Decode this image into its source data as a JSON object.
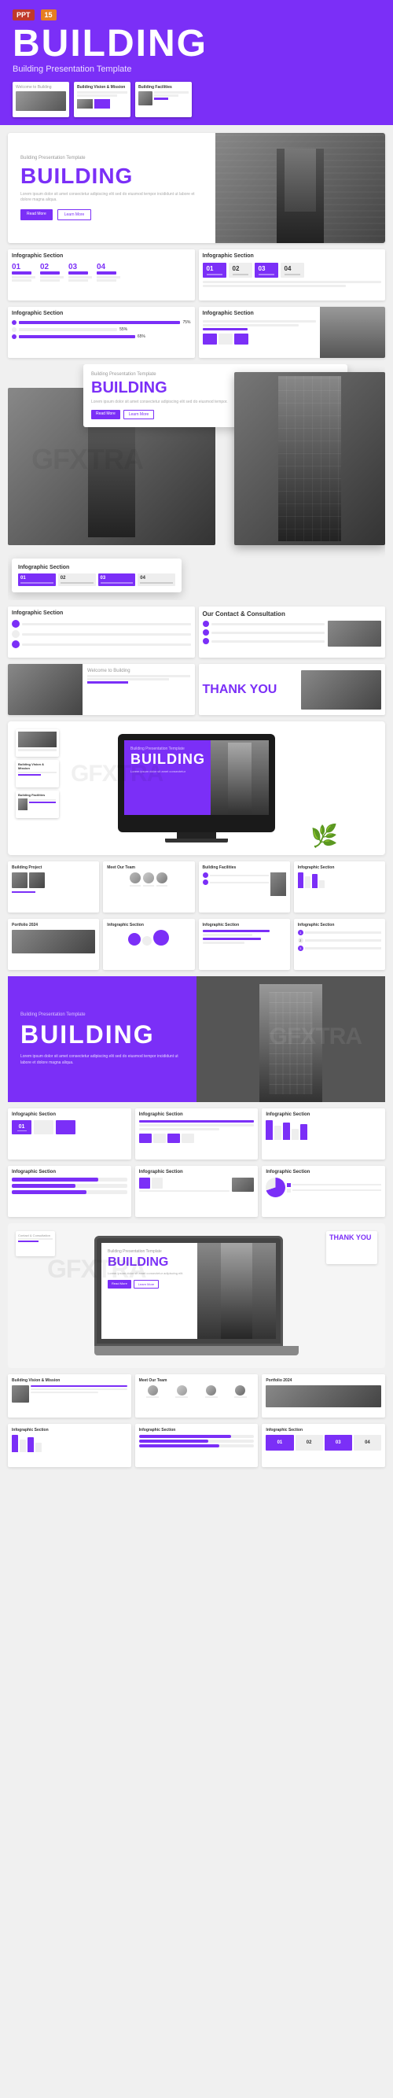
{
  "header": {
    "format_badge": "PPT",
    "extra_badge": "15",
    "title": "BUILDING",
    "subtitle": "Building Presentation Template"
  },
  "slides": {
    "cover": {
      "pretitle": "Building Presentation Template",
      "title": "BUILDING",
      "description": "Lorem ipsum dolor sit amet consectetur adipiscing elit sed do eiusmod tempor incididunt ut labore et dolore magna aliqua.",
      "btn1": "Read More",
      "btn2": "Learn More"
    },
    "section_titles": {
      "infographic": "Infographic Section",
      "vision_mission": "Building Vision & Mission",
      "facilities": "Building Facilities",
      "project": "Building Project",
      "team": "Meet Our Team",
      "portfolio": "Portfolio 2024",
      "contact": "Our Contact & Consultation",
      "thank_you": "THANK YOU",
      "infographic_section": "Infographic Section"
    },
    "stats": {
      "s1": "01",
      "s2": "02",
      "s3": "03",
      "s4": "04"
    },
    "watermark": "GFXTRA"
  },
  "footer": {
    "watermark1": "GFXTRA",
    "watermark2": "GFXTRA"
  }
}
